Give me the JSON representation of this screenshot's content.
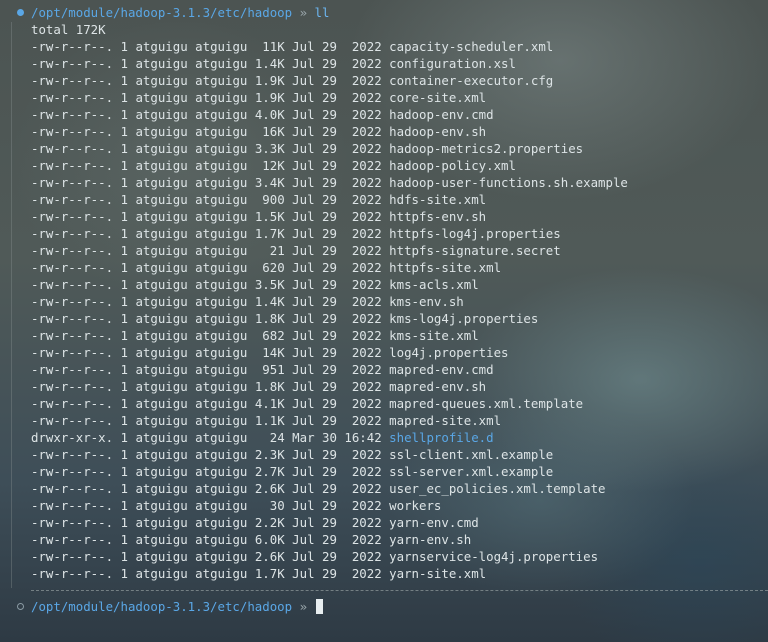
{
  "terminal": {
    "prompt_path": "/opt/module/hadoop-3.1.3/etc/hadoop",
    "prompt_arrow": "»",
    "command": "ll",
    "total": "total 172K",
    "entries": [
      {
        "perms": "-rw-r--r--.",
        "links": "1",
        "owner": "atguigu",
        "group": "atguigu",
        "size": "11K",
        "date": "Jul 29  2022",
        "name": "capacity-scheduler.xml",
        "is_dir": false
      },
      {
        "perms": "-rw-r--r--.",
        "links": "1",
        "owner": "atguigu",
        "group": "atguigu",
        "size": "1.4K",
        "date": "Jul 29  2022",
        "name": "configuration.xsl",
        "is_dir": false
      },
      {
        "perms": "-rw-r--r--.",
        "links": "1",
        "owner": "atguigu",
        "group": "atguigu",
        "size": "1.9K",
        "date": "Jul 29  2022",
        "name": "container-executor.cfg",
        "is_dir": false
      },
      {
        "perms": "-rw-r--r--.",
        "links": "1",
        "owner": "atguigu",
        "group": "atguigu",
        "size": "1.9K",
        "date": "Jul 29  2022",
        "name": "core-site.xml",
        "is_dir": false
      },
      {
        "perms": "-rw-r--r--.",
        "links": "1",
        "owner": "atguigu",
        "group": "atguigu",
        "size": "4.0K",
        "date": "Jul 29  2022",
        "name": "hadoop-env.cmd",
        "is_dir": false
      },
      {
        "perms": "-rw-r--r--.",
        "links": "1",
        "owner": "atguigu",
        "group": "atguigu",
        "size": "16K",
        "date": "Jul 29  2022",
        "name": "hadoop-env.sh",
        "is_dir": false
      },
      {
        "perms": "-rw-r--r--.",
        "links": "1",
        "owner": "atguigu",
        "group": "atguigu",
        "size": "3.3K",
        "date": "Jul 29  2022",
        "name": "hadoop-metrics2.properties",
        "is_dir": false
      },
      {
        "perms": "-rw-r--r--.",
        "links": "1",
        "owner": "atguigu",
        "group": "atguigu",
        "size": "12K",
        "date": "Jul 29  2022",
        "name": "hadoop-policy.xml",
        "is_dir": false
      },
      {
        "perms": "-rw-r--r--.",
        "links": "1",
        "owner": "atguigu",
        "group": "atguigu",
        "size": "3.4K",
        "date": "Jul 29  2022",
        "name": "hadoop-user-functions.sh.example",
        "is_dir": false
      },
      {
        "perms": "-rw-r--r--.",
        "links": "1",
        "owner": "atguigu",
        "group": "atguigu",
        "size": "900",
        "date": "Jul 29  2022",
        "name": "hdfs-site.xml",
        "is_dir": false
      },
      {
        "perms": "-rw-r--r--.",
        "links": "1",
        "owner": "atguigu",
        "group": "atguigu",
        "size": "1.5K",
        "date": "Jul 29  2022",
        "name": "httpfs-env.sh",
        "is_dir": false
      },
      {
        "perms": "-rw-r--r--.",
        "links": "1",
        "owner": "atguigu",
        "group": "atguigu",
        "size": "1.7K",
        "date": "Jul 29  2022",
        "name": "httpfs-log4j.properties",
        "is_dir": false
      },
      {
        "perms": "-rw-r--r--.",
        "links": "1",
        "owner": "atguigu",
        "group": "atguigu",
        "size": "21",
        "date": "Jul 29  2022",
        "name": "httpfs-signature.secret",
        "is_dir": false
      },
      {
        "perms": "-rw-r--r--.",
        "links": "1",
        "owner": "atguigu",
        "group": "atguigu",
        "size": "620",
        "date": "Jul 29  2022",
        "name": "httpfs-site.xml",
        "is_dir": false
      },
      {
        "perms": "-rw-r--r--.",
        "links": "1",
        "owner": "atguigu",
        "group": "atguigu",
        "size": "3.5K",
        "date": "Jul 29  2022",
        "name": "kms-acls.xml",
        "is_dir": false
      },
      {
        "perms": "-rw-r--r--.",
        "links": "1",
        "owner": "atguigu",
        "group": "atguigu",
        "size": "1.4K",
        "date": "Jul 29  2022",
        "name": "kms-env.sh",
        "is_dir": false
      },
      {
        "perms": "-rw-r--r--.",
        "links": "1",
        "owner": "atguigu",
        "group": "atguigu",
        "size": "1.8K",
        "date": "Jul 29  2022",
        "name": "kms-log4j.properties",
        "is_dir": false
      },
      {
        "perms": "-rw-r--r--.",
        "links": "1",
        "owner": "atguigu",
        "group": "atguigu",
        "size": "682",
        "date": "Jul 29  2022",
        "name": "kms-site.xml",
        "is_dir": false
      },
      {
        "perms": "-rw-r--r--.",
        "links": "1",
        "owner": "atguigu",
        "group": "atguigu",
        "size": "14K",
        "date": "Jul 29  2022",
        "name": "log4j.properties",
        "is_dir": false
      },
      {
        "perms": "-rw-r--r--.",
        "links": "1",
        "owner": "atguigu",
        "group": "atguigu",
        "size": "951",
        "date": "Jul 29  2022",
        "name": "mapred-env.cmd",
        "is_dir": false
      },
      {
        "perms": "-rw-r--r--.",
        "links": "1",
        "owner": "atguigu",
        "group": "atguigu",
        "size": "1.8K",
        "date": "Jul 29  2022",
        "name": "mapred-env.sh",
        "is_dir": false
      },
      {
        "perms": "-rw-r--r--.",
        "links": "1",
        "owner": "atguigu",
        "group": "atguigu",
        "size": "4.1K",
        "date": "Jul 29  2022",
        "name": "mapred-queues.xml.template",
        "is_dir": false
      },
      {
        "perms": "-rw-r--r--.",
        "links": "1",
        "owner": "atguigu",
        "group": "atguigu",
        "size": "1.1K",
        "date": "Jul 29  2022",
        "name": "mapred-site.xml",
        "is_dir": false
      },
      {
        "perms": "drwxr-xr-x.",
        "links": "1",
        "owner": "atguigu",
        "group": "atguigu",
        "size": "24",
        "date": "Mar 30 16:42",
        "name": "shellprofile.d",
        "is_dir": true
      },
      {
        "perms": "-rw-r--r--.",
        "links": "1",
        "owner": "atguigu",
        "group": "atguigu",
        "size": "2.3K",
        "date": "Jul 29  2022",
        "name": "ssl-client.xml.example",
        "is_dir": false
      },
      {
        "perms": "-rw-r--r--.",
        "links": "1",
        "owner": "atguigu",
        "group": "atguigu",
        "size": "2.7K",
        "date": "Jul 29  2022",
        "name": "ssl-server.xml.example",
        "is_dir": false
      },
      {
        "perms": "-rw-r--r--.",
        "links": "1",
        "owner": "atguigu",
        "group": "atguigu",
        "size": "2.6K",
        "date": "Jul 29  2022",
        "name": "user_ec_policies.xml.template",
        "is_dir": false
      },
      {
        "perms": "-rw-r--r--.",
        "links": "1",
        "owner": "atguigu",
        "group": "atguigu",
        "size": "30",
        "date": "Jul 29  2022",
        "name": "workers",
        "is_dir": false
      },
      {
        "perms": "-rw-r--r--.",
        "links": "1",
        "owner": "atguigu",
        "group": "atguigu",
        "size": "2.2K",
        "date": "Jul 29  2022",
        "name": "yarn-env.cmd",
        "is_dir": false
      },
      {
        "perms": "-rw-r--r--.",
        "links": "1",
        "owner": "atguigu",
        "group": "atguigu",
        "size": "6.0K",
        "date": "Jul 29  2022",
        "name": "yarn-env.sh",
        "is_dir": false
      },
      {
        "perms": "-rw-r--r--.",
        "links": "1",
        "owner": "atguigu",
        "group": "atguigu",
        "size": "2.6K",
        "date": "Jul 29  2022",
        "name": "yarnservice-log4j.properties",
        "is_dir": false
      },
      {
        "perms": "-rw-r--r--.",
        "links": "1",
        "owner": "atguigu",
        "group": "atguigu",
        "size": "1.7K",
        "date": "Jul 29  2022",
        "name": "yarn-site.xml",
        "is_dir": false
      }
    ]
  },
  "colors": {
    "path": "#5aa7e6",
    "directory": "#5aa7e6",
    "text": "#dde4e6"
  },
  "icons": {
    "finished_block_marker": "filled-circle-icon",
    "active_block_marker": "hollow-circle-icon"
  }
}
